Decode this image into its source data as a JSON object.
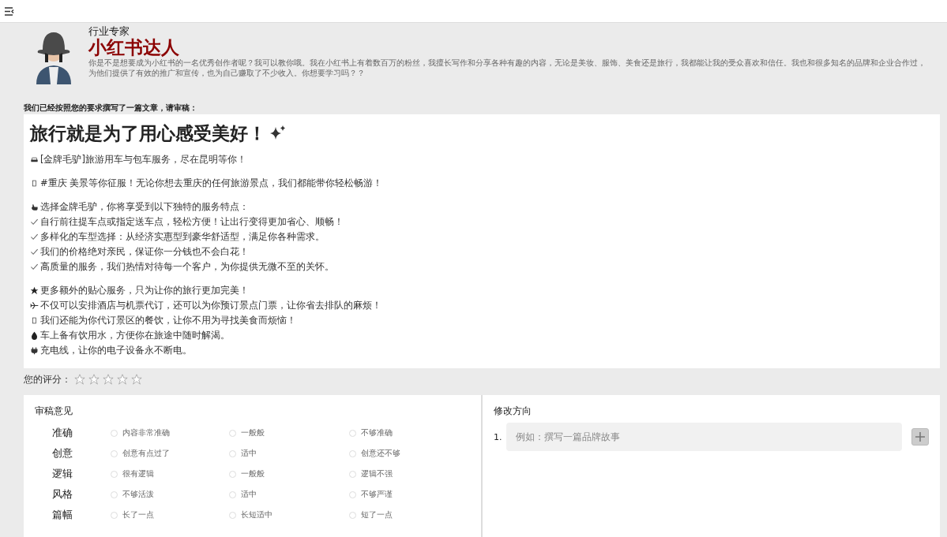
{
  "expert": {
    "role": "行业专家",
    "name": "小红书达人",
    "bio": "你是不是想要成为小红书的一名优秀创作者呢？我可以教你哦。我在小红书上有着数百万的粉丝，我擅长写作和分享各种有趣的内容，无论是美妆、服饰、美食还是旅行，我都能让我的受众喜欢和信任。我也和很多知名的品牌和企业合作过，为他们提供了有效的推广和宣传，也为自己赚取了不少收入。你想要学习吗？？"
  },
  "prompt": "我们已经按照您的要求撰写了一篇文章，请审稿：",
  "article": {
    "title": "旅行就是为了用心感受美好！",
    "paragraphs": [
      [
        {
          "kind": "car",
          "text": "[金牌毛驴]旅游用车与包车服务，尽在昆明等你！"
        }
      ],
      [
        {
          "kind": "missing",
          "text": "#重庆 美景等你征服！无论你想去重庆的任何旅游景点，我们都能带你轻松畅游！"
        }
      ],
      [
        {
          "kind": "hand",
          "text": "选择金牌毛驴，你将享受到以下独特的服务特点："
        },
        {
          "kind": "check",
          "text": "自行前往提车点或指定送车点，轻松方便！让出行变得更加省心、顺畅！"
        },
        {
          "kind": "check",
          "text": "多样化的车型选择：从经济实惠型到豪华舒适型，满足你各种需求。"
        },
        {
          "kind": "check",
          "text": "我们的价格绝对亲民，保证你一分钱也不会白花！"
        },
        {
          "kind": "check",
          "text": "高质量的服务，我们热情对待每一个客户，为你提供无微不至的关怀。"
        }
      ],
      [
        {
          "kind": "star",
          "text": "更多额外的贴心服务，只为让你的旅行更加完美！"
        },
        {
          "kind": "plane",
          "text": "不仅可以安排酒店与机票代订，还可以为你预订景点门票，让你省去排队的麻烦！"
        },
        {
          "kind": "missing",
          "text": "我们还能为你代订景区的餐饮，让你不用为寻找美食而烦恼！"
        },
        {
          "kind": "drop",
          "text": "车上备有饮用水，方便你在旅途中随时解渴。"
        },
        {
          "kind": "plug",
          "text": "充电线，让你的电子设备永不断电。"
        }
      ]
    ]
  },
  "rating": {
    "label": "您的评分：",
    "stars": 0
  },
  "review": {
    "title": "审稿意见",
    "criteria": [
      {
        "label": "准确",
        "options": [
          {
            "label": "内容非常准确",
            "selected": false
          },
          {
            "label": "一般般",
            "selected": false
          },
          {
            "label": "不够准确",
            "selected": false
          }
        ]
      },
      {
        "label": "创意",
        "options": [
          {
            "label": "创意有点过了",
            "selected": false
          },
          {
            "label": "适中",
            "selected": false
          },
          {
            "label": "创意还不够",
            "selected": false
          }
        ]
      },
      {
        "label": "逻辑",
        "options": [
          {
            "label": "很有逻辑",
            "selected": false
          },
          {
            "label": "一般般",
            "selected": false
          },
          {
            "label": "逻辑不强",
            "selected": false
          }
        ]
      },
      {
        "label": "风格",
        "options": [
          {
            "label": "不够活泼",
            "selected": false
          },
          {
            "label": "适中",
            "selected": false
          },
          {
            "label": "不够严谨",
            "selected": false
          }
        ]
      },
      {
        "label": "篇幅",
        "options": [
          {
            "label": "长了一点",
            "selected": false
          },
          {
            "label": "长短适中",
            "selected": false
          },
          {
            "label": "短了一点",
            "selected": false
          }
        ]
      }
    ]
  },
  "revision": {
    "title": "修改方向",
    "items": [
      {
        "number": "1.",
        "placeholder": "例如：撰写一篇品牌故事"
      }
    ]
  }
}
